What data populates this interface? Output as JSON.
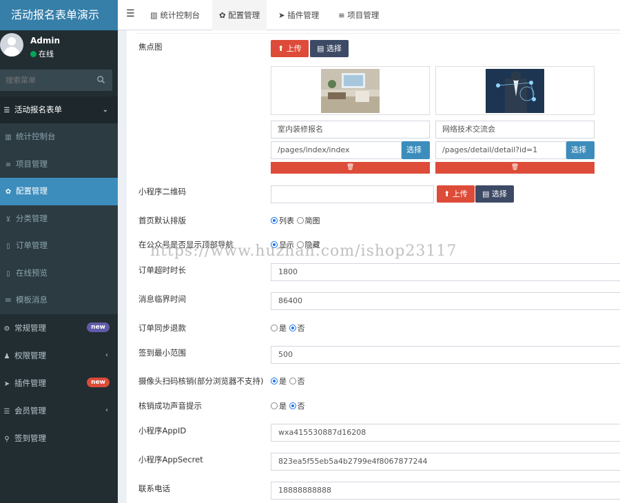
{
  "app": {
    "title": "活动报名表单演示"
  },
  "user": {
    "name": "Admin",
    "status": "在线"
  },
  "search": {
    "placeholder": "搜索菜单"
  },
  "sidebar": {
    "group": "活动报名表单",
    "items": [
      {
        "label": "统计控制台",
        "icon": "chart-icon"
      },
      {
        "label": "项目管理",
        "icon": "list-icon"
      },
      {
        "label": "配置管理",
        "icon": "gear-icon"
      },
      {
        "label": "分类管理",
        "icon": "cart-icon"
      },
      {
        "label": "订单管理",
        "icon": "document-icon"
      },
      {
        "label": "在线预览",
        "icon": "mobile-icon"
      },
      {
        "label": "模板消息",
        "icon": "envelope-icon"
      }
    ],
    "top_items": [
      {
        "label": "常规管理",
        "badge": "new",
        "badge_color": "#605ca8"
      },
      {
        "label": "权限管理"
      },
      {
        "label": "插件管理",
        "badge": "new",
        "badge_color": "#dd4b39"
      },
      {
        "label": "会员管理"
      },
      {
        "label": "签到管理"
      }
    ]
  },
  "tabs": [
    "统计控制台",
    "配置管理",
    "插件管理",
    "项目管理"
  ],
  "form": {
    "focus_image_label": "焦点图",
    "upload_label": "上传",
    "choose_label": "选择",
    "slides": [
      {
        "title": "室内装修报名",
        "path": "/pages/index/index"
      },
      {
        "title": "网络技术交流会",
        "path": "/pages/detail/detail?id=1"
      }
    ],
    "qrcode_label": "小程序二维码",
    "layout_label": "首页默认排版",
    "layout_options": [
      "列表",
      "简图"
    ],
    "topnav_label": "在公众号是否显示顶部导航",
    "topnav_options": [
      "显示",
      "隐藏"
    ],
    "timeout_label": "订单超时时长",
    "timeout_value": "1800",
    "msg_time_label": "消息临界时间",
    "msg_time_value": "86400",
    "sync_refund_label": "订单同步退款",
    "yes": "是",
    "no": "否",
    "checkin_range_label": "签到最小范围",
    "checkin_range_value": "500",
    "camera_label": "摄像头扫码核销(部分浏览器不支持)",
    "sound_label": "核销成功声音提示",
    "appid_label": "小程序AppID",
    "appid_value": "wxa415530887d16208",
    "secret_label": "小程序AppSecret",
    "secret_value": "823ea5f55eb5a4b2799e4f8067877244",
    "phone_label": "联系电话",
    "phone_value": "18888888888"
  },
  "watermark": "https://www.huzhan.com/ishop23117"
}
